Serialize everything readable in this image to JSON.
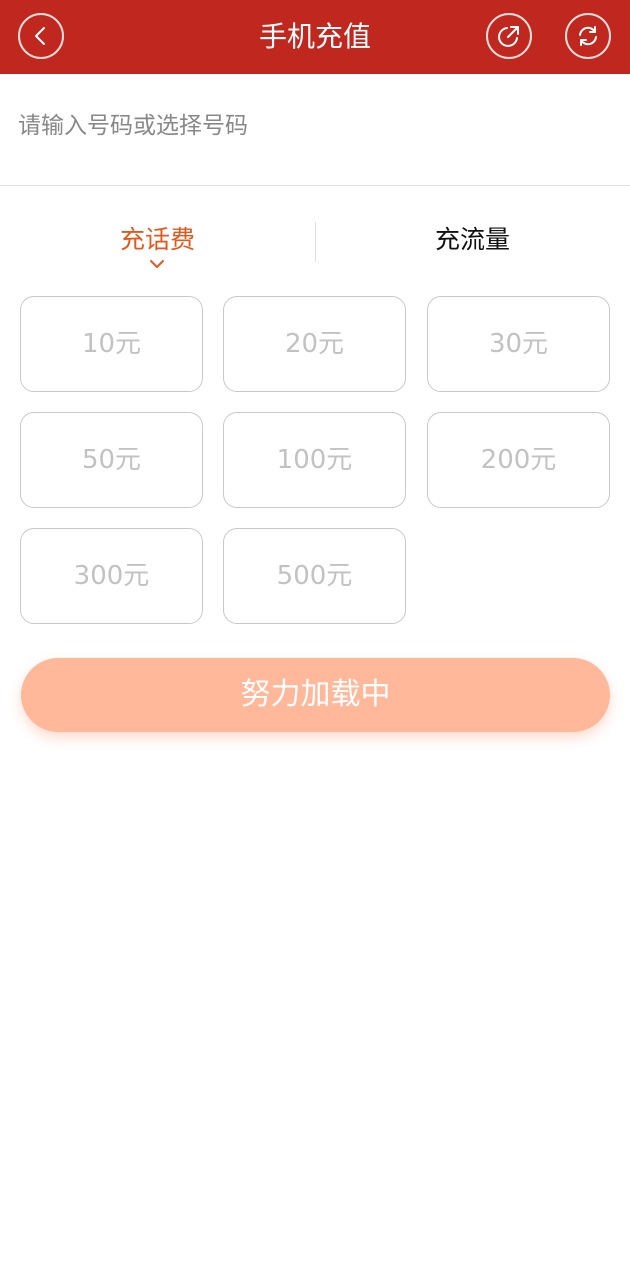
{
  "header": {
    "title": "手机充值",
    "back_icon": "chevron-left-icon",
    "share_icon": "share-external-icon",
    "refresh_icon": "refresh-icon",
    "background_color": "#c0281f"
  },
  "phone": {
    "value": "",
    "placeholder": "请输入号码或选择号码"
  },
  "tabs": [
    {
      "label": "充话费",
      "active": true
    },
    {
      "label": "充流量",
      "active": false
    }
  ],
  "amounts": [
    "10元",
    "20元",
    "30元",
    "50元",
    "100元",
    "200元",
    "300元",
    "500元"
  ],
  "action": {
    "label": "努力加载中",
    "color": "#ffb89a"
  },
  "colors": {
    "accent": "#e2591d"
  }
}
